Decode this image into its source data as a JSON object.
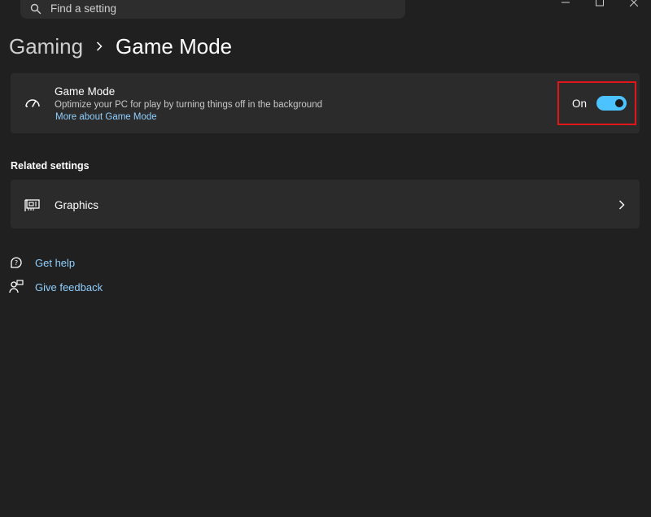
{
  "search": {
    "placeholder": "Find a setting"
  },
  "breadcrumb": {
    "parent": "Gaming",
    "current": "Game Mode"
  },
  "game_mode_card": {
    "title": "Game Mode",
    "description": "Optimize your PC for play by turning things off in the background",
    "link": "More about Game Mode",
    "toggle_state": "On",
    "toggle_on": true
  },
  "related": {
    "heading": "Related settings",
    "graphics_label": "Graphics"
  },
  "help": {
    "get_help": "Get help",
    "give_feedback": "Give feedback"
  },
  "colors": {
    "background": "#202020",
    "card": "#2b2b2b",
    "accent": "#4cc2ff",
    "link": "#8fd0ff",
    "highlight": "#e0161b"
  },
  "icons": {
    "search": "search-icon",
    "game_mode": "speedometer-icon",
    "graphics": "graphics-card-icon",
    "chevron": "chevron-right-icon",
    "help": "help-icon",
    "feedback": "feedback-icon"
  }
}
